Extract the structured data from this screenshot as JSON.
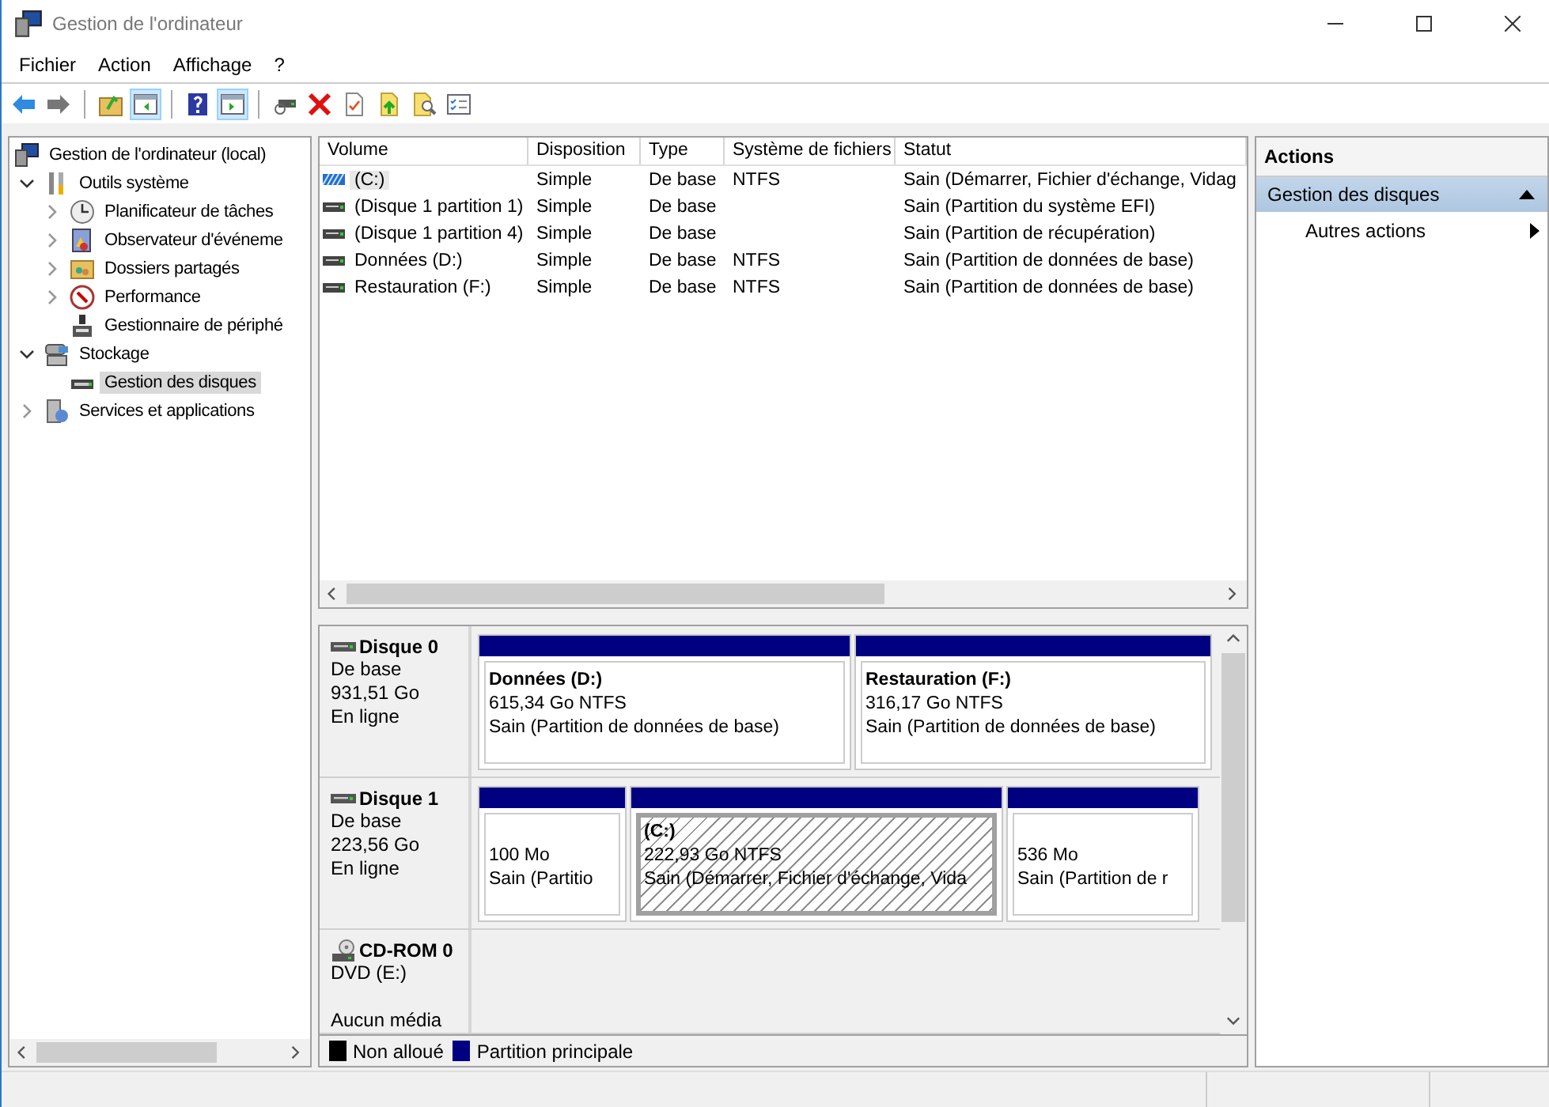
{
  "window": {
    "title": "Gestion de l'ordinateur"
  },
  "menu": [
    "Fichier",
    "Action",
    "Affichage",
    "?"
  ],
  "toolbar": [
    [
      {
        "pressed": false
      },
      {
        "pressed": false
      }
    ],
    [
      {
        "pressed": false
      },
      {
        "pressed": true
      }
    ],
    [
      {
        "pressed": false
      },
      {
        "pressed": true
      }
    ],
    [
      {
        "pressed": false
      },
      {
        "pressed": false
      },
      {
        "pressed": false
      },
      {
        "pressed": false
      },
      {
        "pressed": false
      },
      {
        "pressed": false
      }
    ]
  ],
  "tree": {
    "label": "Gestion de l'ordinateur (local)",
    "children": [
      {
        "label": "Outils système",
        "expanded": true,
        "children": [
          {
            "label": "Planificateur de tâches",
            "expanded": false
          },
          {
            "label": "Observateur d'événeme",
            "expanded": false
          },
          {
            "label": "Dossiers partagés",
            "expanded": false
          },
          {
            "label": "Performance",
            "expanded": false
          },
          {
            "label": "Gestionnaire de périphé"
          }
        ]
      },
      {
        "label": "Stockage",
        "expanded": true,
        "children": [
          {
            "label": "Gestion des disques",
            "selected": true
          }
        ]
      },
      {
        "label": "Services et applications",
        "expanded": false
      }
    ]
  },
  "table": {
    "columns": [
      "Volume",
      "Disposition",
      "Type",
      "Système de fichiers",
      "Statut"
    ],
    "rows": [
      {
        "selected": true,
        "cells": [
          "(C:)",
          "Simple",
          "De base",
          "NTFS",
          "Sain (Démarrer, Fichier d'échange, Vidag"
        ]
      },
      {
        "selected": false,
        "cells": [
          "(Disque 1 partition 1)",
          "Simple",
          "De base",
          "",
          "Sain (Partition du système EFI)"
        ]
      },
      {
        "selected": false,
        "cells": [
          "(Disque 1 partition 4)",
          "Simple",
          "De base",
          "",
          "Sain (Partition de récupération)"
        ]
      },
      {
        "selected": false,
        "cells": [
          "Données (D:)",
          "Simple",
          "De base",
          "NTFS",
          "Sain (Partition de données de base)"
        ]
      },
      {
        "selected": false,
        "cells": [
          "Restauration (F:)",
          "Simple",
          "De base",
          "NTFS",
          "Sain (Partition de données de base)"
        ]
      }
    ]
  },
  "disks": [
    {
      "kind": "disk",
      "name": "Disque 0",
      "lines": [
        "De base",
        "931,51 Go",
        "En ligne"
      ],
      "partitions": [
        {
          "label": "Données  (D:)",
          "size": "615,34 Go NTFS",
          "status": "Sain (Partition de données de base)",
          "selected": false
        },
        {
          "label": "Restauration  (F:)",
          "size": "316,17 Go NTFS",
          "status": "Sain (Partition de données de base)",
          "selected": false
        }
      ]
    },
    {
      "kind": "disk",
      "name": "Disque 1",
      "lines": [
        "De base",
        "223,56 Go",
        "En ligne"
      ],
      "partitions": [
        {
          "size": "100 Mo",
          "status": "Sain (Partitio",
          "selected": false
        },
        {
          "label": "(C:)",
          "size": "222,93 Go NTFS",
          "status": "Sain (Démarrer, Fichier d'échange, Vida",
          "selected": true
        },
        {
          "size": "536 Mo",
          "status": "Sain (Partition de r",
          "selected": false
        }
      ]
    },
    {
      "kind": "cdrom",
      "name": "CD-ROM 0",
      "lines": [
        "DVD (E:)",
        "Aucun média"
      ]
    }
  ],
  "legend": [
    {
      "label": "Non alloué",
      "color": "#000000"
    },
    {
      "label": "Partition principale",
      "color": "#000080"
    }
  ],
  "actions": {
    "title": "Actions",
    "section": {
      "label": "Gestion des disques",
      "expanded": true
    },
    "items": [
      "Autres actions"
    ]
  }
}
